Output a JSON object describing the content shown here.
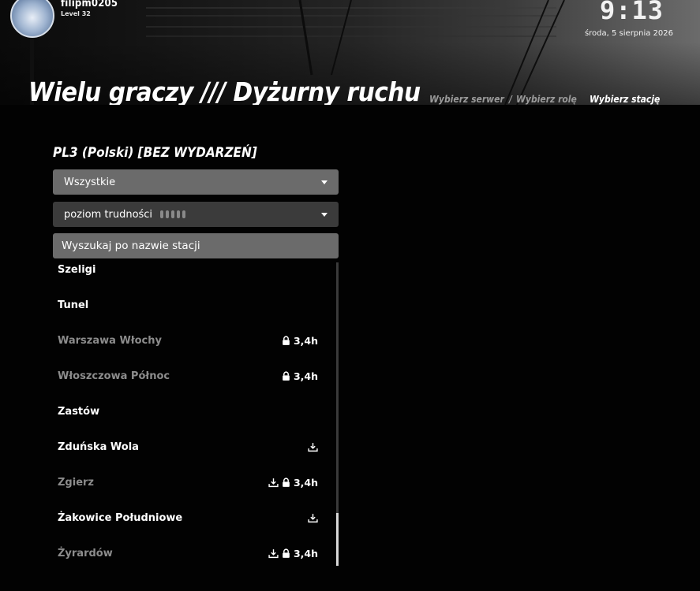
{
  "user": {
    "name": "filipm0205",
    "level": "Level 32"
  },
  "clock": {
    "time": "9:13",
    "date": "środa, 5 sierpnia 2026"
  },
  "page_title": "Wielu graczy /// Dyżurny ruchu",
  "steps": {
    "server": "Wybierz serwer",
    "separator": "/",
    "role": "Wybierz rolę",
    "station": "Wybierz stację"
  },
  "server_name": "PL3 (Polski) [BEZ WYDARZEŃ]",
  "filters": {
    "region": "Wszystkie",
    "difficulty_label": "poziom trudności",
    "search_placeholder": "Wyszukaj po nazwie stacji"
  },
  "stations": [
    {
      "name": "Szeligi",
      "locked": false,
      "download": false,
      "hours": ""
    },
    {
      "name": "Tunel",
      "locked": false,
      "download": false,
      "hours": ""
    },
    {
      "name": "Warszawa Włochy",
      "locked": true,
      "download": false,
      "hours": "3,4h"
    },
    {
      "name": "Włoszczowa Północ",
      "locked": true,
      "download": false,
      "hours": "3,4h"
    },
    {
      "name": "Zastów",
      "locked": false,
      "download": false,
      "hours": ""
    },
    {
      "name": "Zduńska Wola",
      "locked": false,
      "download": true,
      "hours": ""
    },
    {
      "name": "Zgierz",
      "locked": true,
      "download": true,
      "hours": "3,4h"
    },
    {
      "name": "Żakowice Południowe",
      "locked": false,
      "download": true,
      "hours": ""
    },
    {
      "name": "Żyrardów",
      "locked": true,
      "download": true,
      "hours": "3,4h"
    }
  ]
}
